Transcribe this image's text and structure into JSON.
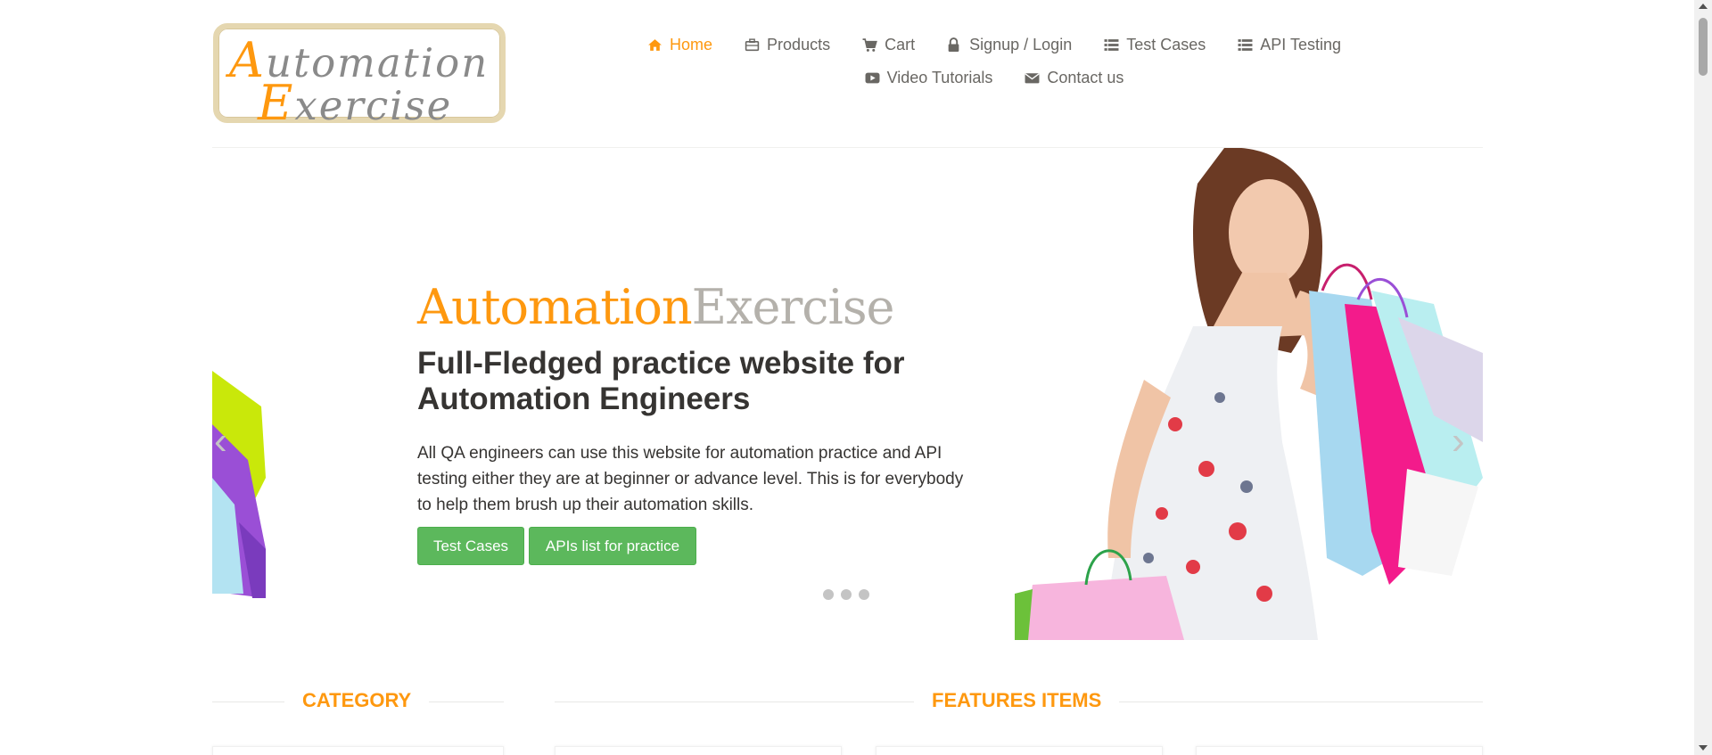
{
  "logo": {
    "line1_cap": "A",
    "line1_rest": "utomation",
    "line2_cap": "E",
    "line2_rest": "xercise"
  },
  "nav": {
    "items": [
      {
        "label": "Home",
        "icon": "home-icon",
        "active": true
      },
      {
        "label": "Products",
        "icon": "briefcase-icon"
      },
      {
        "label": "Cart",
        "icon": "cart-icon"
      },
      {
        "label": "Signup / Login",
        "icon": "lock-icon"
      },
      {
        "label": "Test Cases",
        "icon": "list-icon"
      },
      {
        "label": "API Testing",
        "icon": "list-icon"
      },
      {
        "label": "Video Tutorials",
        "icon": "youtube-icon"
      },
      {
        "label": "Contact us",
        "icon": "envelope-icon"
      }
    ]
  },
  "slider": {
    "brand_a": "Automation",
    "brand_b": "Exercise",
    "headline": "Full-Fledged practice website for Automation Engineers",
    "description": "All QA engineers can use this website for automation practice and API testing either they are at beginner or advance level. This is for everybody to help them brush up their automation skills.",
    "button_test_cases": "Test Cases",
    "button_apis": "APIs list for practice",
    "prev_arrow": "‹",
    "next_arrow": "›"
  },
  "sections": {
    "category": "CATEGORY",
    "features": "FEATURES ITEMS"
  },
  "colors": {
    "accent": "#fe980f",
    "button": "#5cb85c",
    "text": "#696763",
    "heading": "#363432"
  }
}
